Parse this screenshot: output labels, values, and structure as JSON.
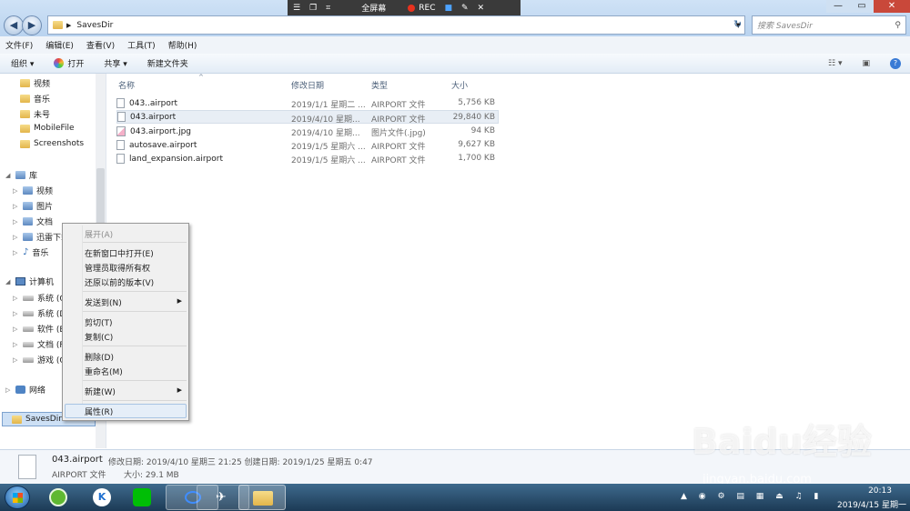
{
  "recorder": {
    "fullscreen_label": "全屏幕",
    "rec_label": "REC",
    "rec_color": "#e8321e"
  },
  "address": {
    "path": "SavesDir",
    "search_placeholder": "搜索 SavesDir"
  },
  "menubar": [
    "文件(F)",
    "编辑(E)",
    "查看(V)",
    "工具(T)",
    "帮助(H)"
  ],
  "toolbar": {
    "organize": "组织 ▾",
    "open": "打开",
    "share": "共享 ▾",
    "new_folder": "新建文件夹"
  },
  "nav": {
    "favorites": [
      "视频",
      "音乐",
      "未号",
      "MobileFile",
      "Screenshots"
    ],
    "library_label": "库",
    "library_items": [
      "视频",
      "图片",
      "文档",
      "迅雷下载",
      "音乐"
    ],
    "computer_label": "计算机",
    "drives": [
      "系统 (C:)",
      "系统 (D:)",
      "软件 (E:)",
      "文档 (F:)",
      "游戏 (G:)"
    ],
    "network_label": "网络",
    "current_folder": "SavesDir"
  },
  "columns": {
    "name": "名称",
    "date": "修改日期",
    "type": "类型",
    "size": "大小"
  },
  "files": [
    {
      "name": "043..airport",
      "date": "2019/1/1 星期二 ...",
      "type": "AIRPORT 文件",
      "size": "5,756 KB"
    },
    {
      "name": "043.airport",
      "date": "2019/4/10 星期...",
      "type": "AIRPORT 文件",
      "size": "29,840 KB"
    },
    {
      "name": "043.airport.jpg",
      "date": "2019/4/10 星期...",
      "type": "图片文件(.jpg)",
      "size": "94 KB"
    },
    {
      "name": "autosave.airport",
      "date": "2019/1/5 星期六 ...",
      "type": "AIRPORT 文件",
      "size": "9,627 KB"
    },
    {
      "name": "land_expansion.airport",
      "date": "2019/1/5 星期六 ...",
      "type": "AIRPORT 文件",
      "size": "1,700 KB"
    }
  ],
  "context_menu": {
    "expand": "展开(A)",
    "open_new_window": "在新窗口中打开(E)",
    "take_ownership": "管理员取得所有权",
    "restore_versions": "还原以前的版本(V)",
    "send_to": "发送到(N)",
    "cut": "剪切(T)",
    "copy": "复制(C)",
    "delete": "删除(D)",
    "rename": "重命名(M)",
    "new": "新建(W)",
    "properties": "属性(R)"
  },
  "details": {
    "filename": "043.airport",
    "modified": "修改日期: 2019/4/10 星期三 21:25 创建日期: 2019/1/25 星期五 0:47",
    "filetype": "AIRPORT 文件",
    "size": "大小: 29.1 MB"
  },
  "clock": {
    "time": "20:13",
    "date": "2019/4/15 星期一"
  },
  "watermark": {
    "brand": "Baidu经验",
    "url": "jingyan.baidu.com"
  }
}
